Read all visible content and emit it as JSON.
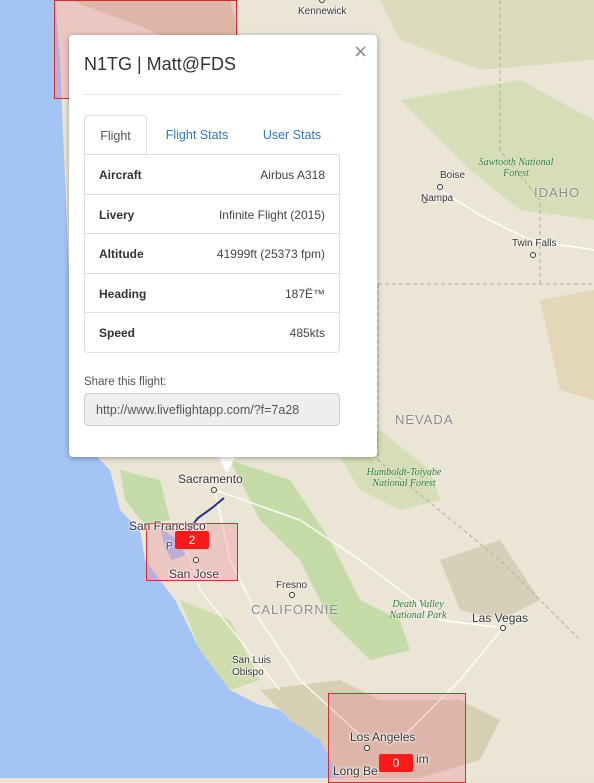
{
  "map": {
    "labels": {
      "kennewick": "Kennewick",
      "boise": "Boise",
      "nampa": "Nampa",
      "twin_falls": "Twin Falls",
      "idaho": "IDAHO",
      "sawtooth": "Sawtooth National Forest",
      "nevada": "NEVADA",
      "humboldt": "Humboldt-Toiyabe National Forest",
      "sacramento": "Sacramento",
      "san_francisco": "San Francisco",
      "san_jose": "San Jose",
      "fresno": "Fresno",
      "california": "CALIFORNIE",
      "death_valley": "Death Valley National Park",
      "las_vegas": "Las Vegas",
      "san_luis_obispo": "San Luis Obispo",
      "los_angeles": "Los Angeles",
      "long_beach": "Long Be",
      "anaheim": "im",
      "pa": "P"
    },
    "clusters": [
      {
        "count": "2"
      },
      {
        "count": "0"
      }
    ],
    "colors": {
      "water": "#a3c4f5",
      "land": "#e9e3d3",
      "forest": "#c5dca8",
      "track": "#2a2a8a",
      "cluster_border": "#d32f2f",
      "badge": "#ff1a1a"
    }
  },
  "popup": {
    "title": "N1TG | Matt@FDS",
    "close_label": "×",
    "tabs": [
      {
        "label": "Flight",
        "active": true
      },
      {
        "label": "Flight Stats",
        "active": false
      },
      {
        "label": "User Stats",
        "active": false
      }
    ],
    "rows": [
      {
        "key": "Aircraft",
        "value": "Airbus A318"
      },
      {
        "key": "Livery",
        "value": "Infinite Flight (2015)"
      },
      {
        "key": "Altitude",
        "value": "41999ft (25373 fpm)"
      },
      {
        "key": "Heading",
        "value": "187Ë™"
      },
      {
        "key": "Speed",
        "value": "485kts"
      }
    ],
    "share_label": "Share this flight:",
    "share_url": "http://www.liveflightapp.com/?f=7a28"
  }
}
